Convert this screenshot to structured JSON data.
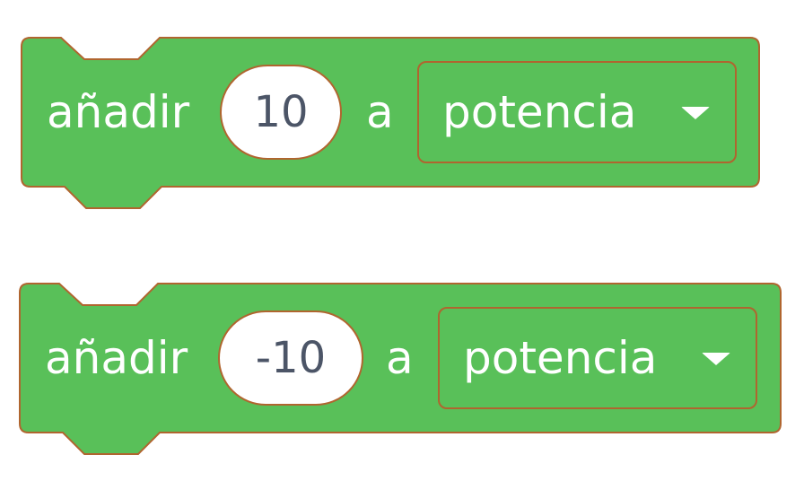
{
  "colors": {
    "block_fill": "#59c059",
    "block_stroke": "#b0652f",
    "input_text": "#4c5567",
    "label_text": "#ffffff"
  },
  "blocks": [
    {
      "label": "añadir",
      "value": "10",
      "connector": "a",
      "variable": "potencia",
      "dropdown_icon": "dropdown-arrow-icon"
    },
    {
      "label": "añadir",
      "value": "-10",
      "connector": "a",
      "variable": "potencia",
      "dropdown_icon": "dropdown-arrow-icon"
    }
  ]
}
